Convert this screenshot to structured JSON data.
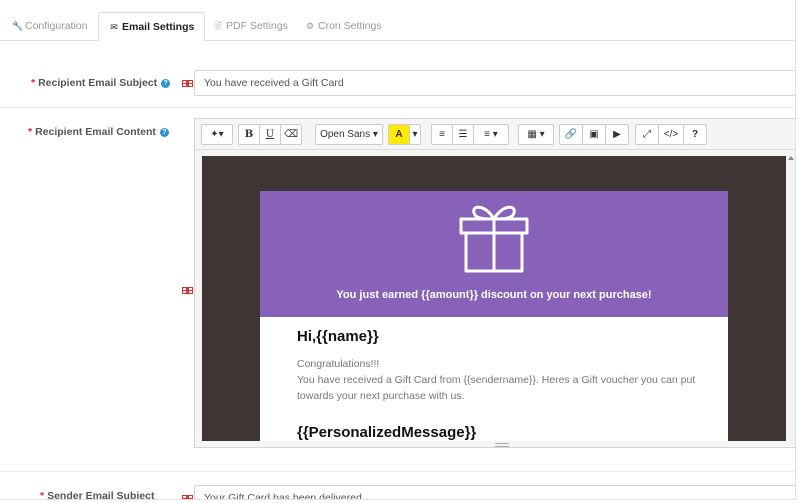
{
  "tabs": [
    {
      "label": "Configuration",
      "icon": "wrench-icon",
      "active": false
    },
    {
      "label": "Email Settings",
      "icon": "envelope-icon",
      "active": true
    },
    {
      "label": "PDF Settings",
      "icon": "pdf-icon",
      "active": false
    },
    {
      "label": "Cron Settings",
      "icon": "gears-icon",
      "active": false
    }
  ],
  "fields": {
    "recipient_subject": {
      "label": "Recipient Email Subject",
      "value": "You have received a Gift Card"
    },
    "recipient_content": {
      "label": "Recipient Email Content"
    },
    "sender_subject": {
      "label": "Sender Email Subject",
      "value": "Your Gift Card has been delivered"
    }
  },
  "toolbar": {
    "font_name": "Open Sans",
    "bold": "B",
    "underline": "U",
    "font_color": "A",
    "code_view": "</>",
    "help": "?"
  },
  "email": {
    "banner_text": "You just earned {{amount}} discount on your next purchase!",
    "greeting": "Hi,{{name}}",
    "line1": "Congratulations!!!",
    "line2": "You have received a Gift Card from {{sendername}}. Heres a Gift voucher you can put towards your next purchase with us.",
    "personalized": "{{PersonalizedMessage}}"
  },
  "colors": {
    "banner": "#8862b9",
    "canvas": "#3e3634",
    "help_badge": "#2d8fd6",
    "required": "#e23",
    "highlight": "#ffea00"
  }
}
